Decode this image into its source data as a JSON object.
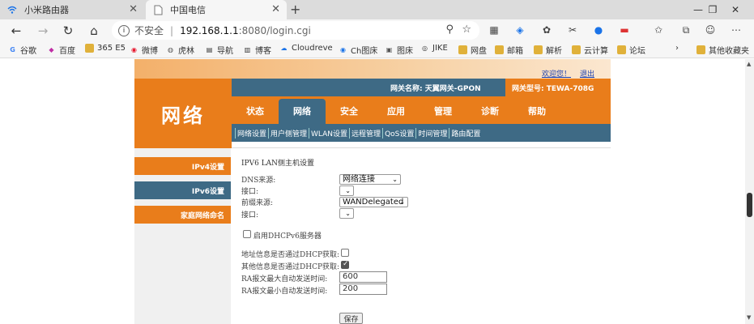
{
  "browser": {
    "tabs": [
      {
        "title": "小米路由器",
        "active": false
      },
      {
        "title": "中国电信",
        "active": true
      }
    ],
    "new_tab_symbol": "+",
    "url": {
      "security_text": "不安全",
      "host": "192.168.1.1",
      "path": ":8080/login.cgi"
    },
    "bookmarks": [
      {
        "label": "谷歌",
        "icon": "google-icon"
      },
      {
        "label": "百度",
        "icon": "baidu-icon"
      },
      {
        "label": "365 E5",
        "icon": "folder-icon"
      },
      {
        "label": "微博",
        "icon": "weibo-icon"
      },
      {
        "label": "虎林",
        "icon": "hulin-icon"
      },
      {
        "label": "导航",
        "icon": "nav-icon"
      },
      {
        "label": "博客",
        "icon": "blog-icon"
      },
      {
        "label": "Cloudreve",
        "icon": "cloudreve-icon"
      },
      {
        "label": "Ch图床",
        "icon": "chtuchuang-icon"
      },
      {
        "label": "图床",
        "icon": "tuchuang-icon"
      },
      {
        "label": "JIKE",
        "icon": "jike-icon"
      },
      {
        "label": "网盘",
        "icon": "folder-icon"
      },
      {
        "label": "邮箱",
        "icon": "folder-icon"
      },
      {
        "label": "解析",
        "icon": "folder-icon"
      },
      {
        "label": "云计算",
        "icon": "folder-icon"
      },
      {
        "label": "论坛",
        "icon": "folder-icon"
      },
      {
        "label": "其他收藏夹",
        "icon": "folder-icon"
      }
    ]
  },
  "router": {
    "welcome": "欢迎您！",
    "logout": "退出",
    "gateway_label": "网关名称:",
    "gateway_name": "天翼网关-GPON",
    "model_label": "网关型号:",
    "model_name": "TEWA-708G",
    "logo_text": "网络",
    "main_tabs": [
      "状态",
      "网络",
      "安全",
      "应用",
      "管理",
      "诊断",
      "帮助"
    ],
    "active_main_tab": "网络",
    "sub_tabs": [
      "网络设置",
      "用户侧管理",
      "WLAN设置",
      "远程管理",
      "QoS设置",
      "时间管理",
      "路由配置"
    ],
    "sidebar": [
      "IPv4设置",
      "IPv6设置",
      "家庭网络命名"
    ],
    "section_title": "IPV6 LAN侧主机设置",
    "fields": {
      "dns_source_label": "DNS来源:",
      "dns_source_value": "网络连接",
      "iface1_label": "接口:",
      "iface1_value": "",
      "prefix_source_label": "前缀来源:",
      "prefix_source_value": "WANDelegated",
      "iface2_label": "接口:",
      "iface2_value": "",
      "dhcpv6_label": "启用DHCPv6服务器",
      "dhcpv6_enabled": false,
      "addr_dhcp_label": "地址信息是否通过DHCP获取:",
      "addr_dhcp_checked": false,
      "other_dhcp_label": "其他信息是否通过DHCP获取:",
      "other_dhcp_checked": true,
      "ra_max_label": "RA报文最大自动发送时间:",
      "ra_max_value": "600",
      "ra_min_label": "RA报文最小自动发送时间:",
      "ra_min_value": "200",
      "save_label": "保存"
    }
  },
  "colors": {
    "orange": "#e97d1b",
    "steel_blue": "#3e6a85"
  }
}
